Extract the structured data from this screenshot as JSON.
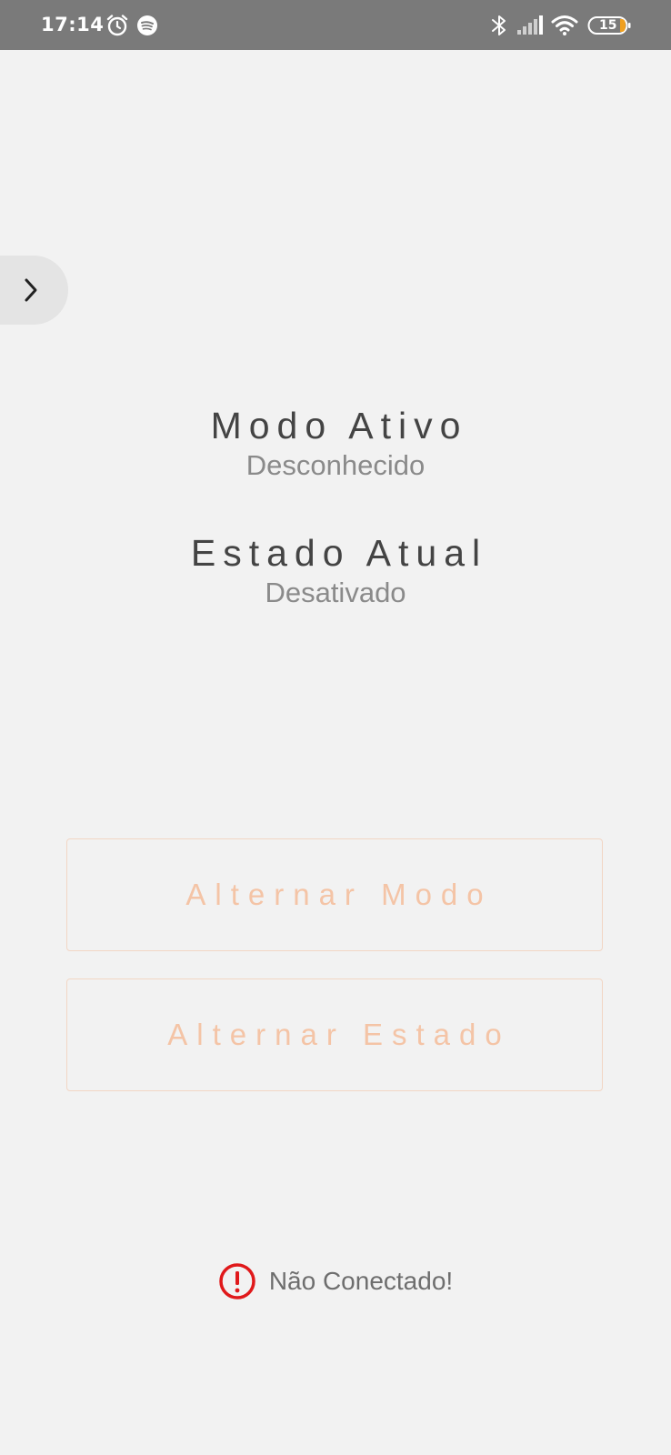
{
  "status_bar": {
    "time": "17:14",
    "battery_level": "15",
    "icons": [
      "alarm-icon",
      "spotify-icon",
      "bluetooth-icon",
      "signal-icon",
      "wifi-icon",
      "battery-icon"
    ]
  },
  "drawer": {
    "icon": "chevron-right-icon"
  },
  "info": {
    "mode_title": "Modo Ativo",
    "mode_value": "Desconhecido",
    "state_title": "Estado Atual",
    "state_value": "Desativado"
  },
  "actions": {
    "toggle_mode_label": "Alternar Modo",
    "toggle_state_label": "Alternar Estado"
  },
  "connection": {
    "status_text": "Não Conectado!",
    "icon": "alert-circle-icon"
  },
  "colors": {
    "background": "#f2f2f2",
    "status_bar": "#7a7a7a",
    "accent_button_text": "#f4c4a6",
    "button_border": "#f2d6c4",
    "error_red": "#e0191b",
    "battery_fill": "#f0a020"
  }
}
